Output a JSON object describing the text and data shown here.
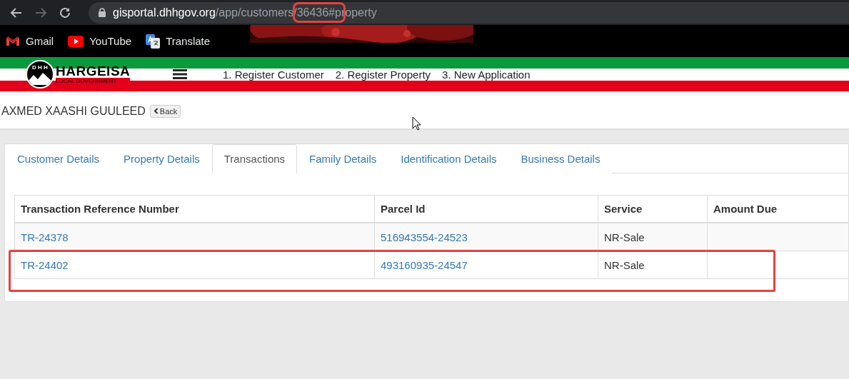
{
  "browser": {
    "url": {
      "host": "gisportal.dhhgov.org",
      "path": "/app/customers/",
      "marked": "36436#p",
      "rest": "roperty"
    },
    "bookmarks": [
      {
        "kind": "gmail",
        "label": "Gmail"
      },
      {
        "kind": "youtube",
        "label": "YouTube"
      },
      {
        "kind": "translate",
        "label": "Translate"
      }
    ]
  },
  "header": {
    "logo": {
      "mark": "D H H",
      "name": "HARGEISA",
      "subtitle": "LOCAL GOVERNMENT"
    },
    "nav": [
      "1. Register Customer",
      "2. Register Property",
      "3. New Application"
    ]
  },
  "customer": {
    "name": "AXMED XAASHI GUULEED",
    "back": "Back"
  },
  "tabs": [
    {
      "label": "Customer Details",
      "selected": false
    },
    {
      "label": "Property Details",
      "selected": false
    },
    {
      "label": "Transactions",
      "selected": true
    },
    {
      "label": "Family Details",
      "selected": false
    },
    {
      "label": "Identification Details",
      "selected": false
    },
    {
      "label": "Business Details",
      "selected": false
    }
  ],
  "table": {
    "columns": [
      "Transaction Reference Number",
      "Parcel Id",
      "Service",
      "Amount Due"
    ],
    "rows": [
      {
        "reference": "TR-24378",
        "parcel": "516943554-24523",
        "service": "NR-Sale",
        "highlighted": false
      },
      {
        "reference": "TR-24402",
        "parcel": "493160935-24547",
        "service": "NR-Sale",
        "highlighted": true
      }
    ]
  }
}
